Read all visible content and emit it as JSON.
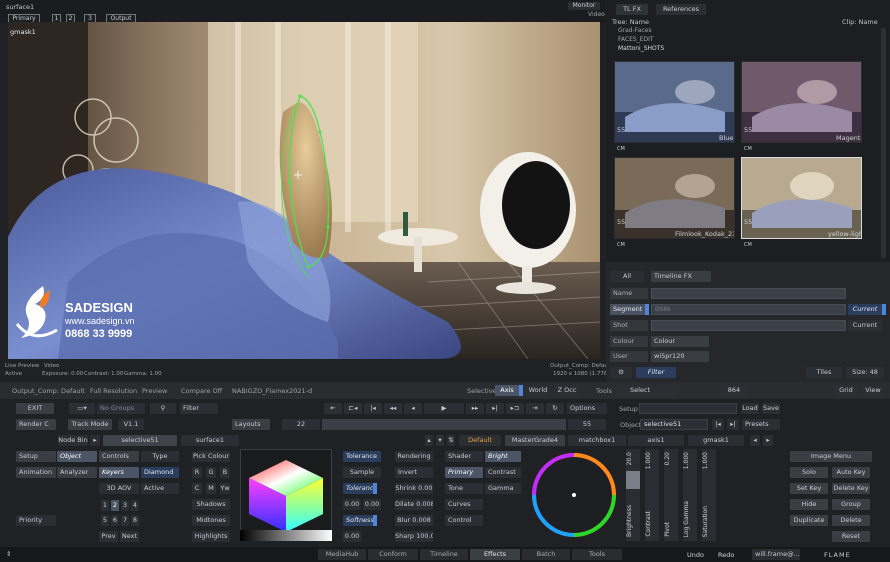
{
  "viewer": {
    "surface_label": "surface1",
    "tabs": [
      "Primary",
      "1",
      "2",
      "3",
      "Output"
    ],
    "monitor_label": "Monitor",
    "video_label": "Video",
    "gmask_label": "gmask1",
    "live_preview": "Live Preview",
    "live_preview_video": "Video",
    "active": "Active",
    "exposure": "Exposure: 0.00",
    "contrast": "Contrast: 1.00",
    "gamma": "Gamma: 1.00",
    "output_comp": "Output_Comp: Default",
    "resolution_info": "1920 x 1080 (1.778)"
  },
  "watermark": {
    "brand": "SADESIGN",
    "url": "www.sadesign.vn",
    "phone": "0868 33 9999"
  },
  "right_panel": {
    "tabs": [
      "TL FX",
      "References"
    ],
    "tree_header": "Tree: Name",
    "clip_header": "Clip: Name",
    "tree_items": [
      "Grad-Faces",
      "FACES_EDIT",
      "Mattoni_SHOTS"
    ],
    "thumbs": [
      {
        "name": "Blue",
        "num": "55",
        "badge": "CM"
      },
      {
        "name": "Magenta",
        "num": "55",
        "badge": "CM"
      },
      {
        "name": "Filmlook_Kodak_2393",
        "num": "55",
        "badge": "CM"
      },
      {
        "name": "yellow-light",
        "num": "55",
        "badge": "CM"
      }
    ],
    "filter_all": "All",
    "filter_scope": "Timeline FX",
    "rows": {
      "name": "Name",
      "segment": "Segment",
      "segment_value": "DS6k",
      "shot": "Shot",
      "colour": "Colour",
      "colour_value": "Colour",
      "user": "User",
      "user_value": "wi5pr120",
      "current1": "Current",
      "current2": "Current"
    },
    "tiles": "Tiles",
    "size": "Size: 48",
    "filter": "Filter"
  },
  "toolbar": {
    "output_comp": "Output_Comp: Default",
    "full_resolution": "Full Resolution",
    "preview": "Preview",
    "compare_off": "Compare Off",
    "clip_name": "NABIGZO_Flamex2021-d",
    "selective": "Selective",
    "axis": "Axis",
    "world": "World",
    "zocc": "Z Occ",
    "tools": "Tools",
    "select": "Select",
    "zoom": "864",
    "grid": "Grid",
    "view": "View"
  },
  "controls": {
    "exit": "EXIT",
    "no_groups": "No Groups",
    "filter": "Filter",
    "render": "Render C",
    "track_mode": "Track Mode",
    "version": "V1.1",
    "layouts": "Layouts",
    "frame_start": "22",
    "frame_end": "55",
    "options": "Options",
    "setup": "Setup",
    "load": "Load",
    "save": "Save",
    "object_label": "Object:",
    "object_value": "selective51",
    "presets": "Presets",
    "node_bin": "Node Bin",
    "node_name": "selective51",
    "surface": "surface1"
  },
  "node_tabs": [
    "Default",
    "MasterGrade4",
    "matchbox1",
    "axis1",
    "gmask1"
  ],
  "left_menu": {
    "setup": "Setup",
    "object": "Object",
    "controls": "Controls",
    "type": "Type",
    "animation": "Animation",
    "analyzer": "Analyzer",
    "keyers": "Keyers",
    "diamond": "Diamond",
    "adv": "3D AOV",
    "active": "Active",
    "priority": "Priority",
    "prev": "Prev",
    "next": "Next",
    "nums": [
      "1",
      "2",
      "3",
      "4",
      "5",
      "6",
      "7",
      "8"
    ]
  },
  "pick": {
    "pick_colour": "Pick Colour",
    "rgb": [
      "R",
      "G",
      "B"
    ],
    "cmy": [
      "C",
      "M",
      "Yw"
    ],
    "shadows": "Shadows",
    "midtones": "Midtones",
    "highlights": "Highlights"
  },
  "keyer": {
    "tolerance": "Tolerance",
    "sample": "Sample",
    "tolerance2": "Tolerance",
    "v1": "0.00",
    "v2": "0.00",
    "softness": "Softness",
    "v3": "0.00"
  },
  "render": {
    "rendering": "Rendering",
    "invert": "Invert",
    "shrink": "Shrink 0.00",
    "dilate": "Dilate 0.008",
    "blur": "Blur 0.008",
    "sharp": "Sharp 100.0"
  },
  "shader": {
    "shader": "Shader",
    "bright": "Bright",
    "primary": "Primary",
    "contrast": "Contrast",
    "tone": "Tone",
    "gamma": "Gamma",
    "curves": "Curves",
    "control": "Control"
  },
  "sliders": [
    {
      "name": "Brightness",
      "value": "20.0"
    },
    {
      "name": "Contrast",
      "value": "1.000"
    },
    {
      "name": "Pivot",
      "value": "0.20"
    },
    {
      "name": "Log Gamma",
      "value": "1.000"
    },
    {
      "name": "Saturation",
      "value": "1.000"
    }
  ],
  "right_buttons": {
    "image_menu": "Image Menu",
    "solo": "Solo",
    "auto_key": "Auto Key",
    "set_key": "Set Key",
    "delete_key": "Delete Key",
    "hide": "Hide",
    "group": "Group",
    "duplicate": "Duplicate",
    "delete": "Delete",
    "reset": "Reset"
  },
  "bottom_bar": {
    "tabs": [
      "MediaHub",
      "Conform",
      "Timeline",
      "Effects",
      "Batch",
      "Tools"
    ],
    "undo": "Undo",
    "redo": "Redo",
    "user": "will.frame@...",
    "flame": "FLAME"
  },
  "colors": {
    "accent_blue": "#4f86d9",
    "panel_bg": "#1f2124",
    "mask_green": "#4ee04e",
    "watermark_orange": "#f47b20"
  }
}
